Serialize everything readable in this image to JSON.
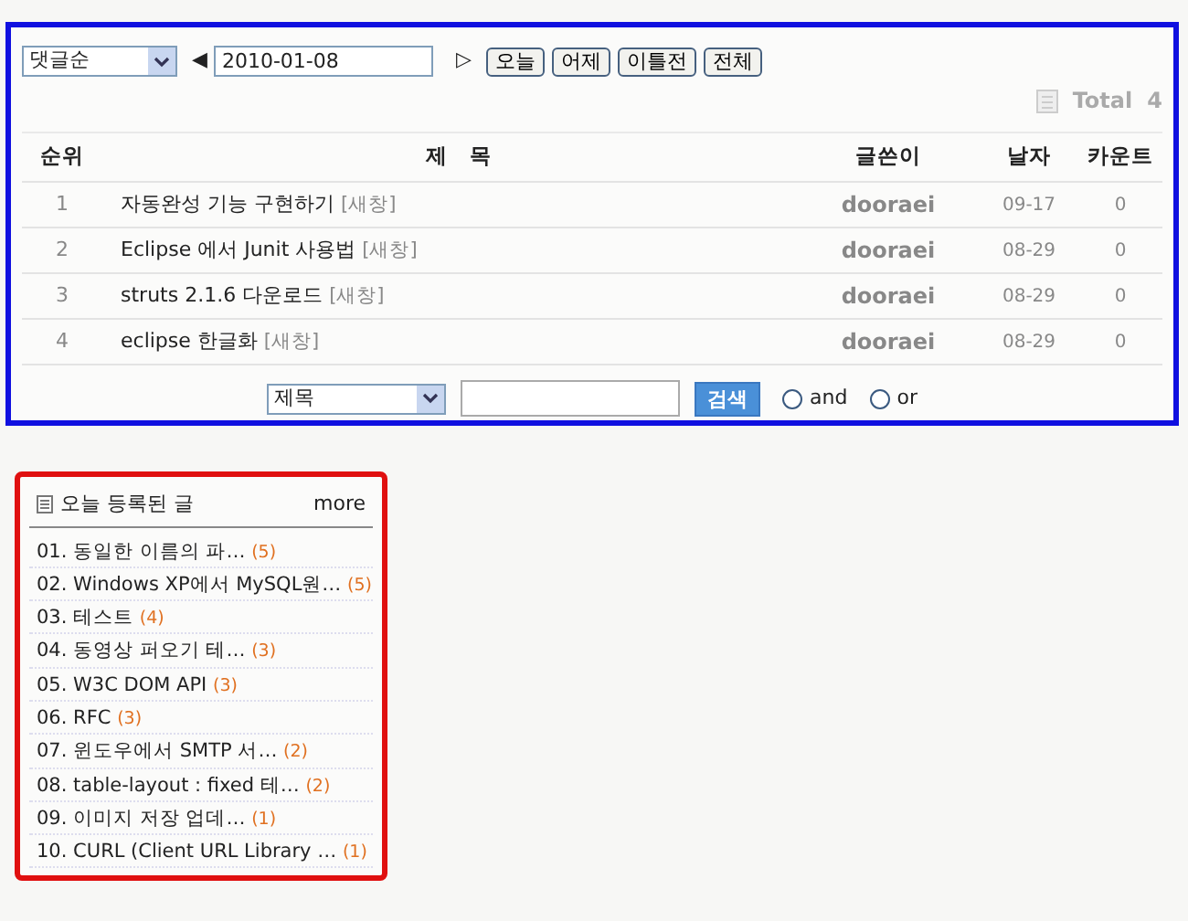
{
  "toolbar": {
    "sort_select": "댓글순",
    "prev_arrow": "◀",
    "date": "2010-01-08",
    "next_arrow": "▷",
    "buttons": [
      "오늘",
      "어제",
      "이틀전",
      "전체"
    ]
  },
  "total": {
    "label": "Total",
    "count": "4"
  },
  "table": {
    "columns": [
      "순위",
      "제　목",
      "글쓴이",
      "날자",
      "카운트"
    ],
    "rows": [
      {
        "rank": "1",
        "title": "자동완성 기능 구현하기 [새창]",
        "author": "dooraei",
        "date": "09-17",
        "count": "0"
      },
      {
        "rank": "2",
        "title": "Eclipse 에서 Junit 사용법 [새창]",
        "author": "dooraei",
        "date": "08-29",
        "count": "0"
      },
      {
        "rank": "3",
        "title": "struts 2.1.6 다운로드 [새창]",
        "author": "dooraei",
        "date": "08-29",
        "count": "0"
      },
      {
        "rank": "4",
        "title": "eclipse 한글화 [새창]",
        "author": "dooraei",
        "date": "08-29",
        "count": "0"
      }
    ]
  },
  "search": {
    "field_select": "제목",
    "button": "검색",
    "options": [
      {
        "label": "and",
        "selected": false
      },
      {
        "label": "or",
        "selected": false
      }
    ]
  },
  "today_posts": {
    "title": "오늘 등록된 글",
    "more": "more",
    "items": [
      {
        "number": "01.",
        "title": "동일한 이름의 파…",
        "count": "(5)"
      },
      {
        "number": "02.",
        "title": "Windows XP에서 MySQL원…",
        "count": "(5)"
      },
      {
        "number": "03.",
        "title": "테스트",
        "count": "(4)"
      },
      {
        "number": "04.",
        "title": "동영상 퍼오기 테…",
        "count": "(3)"
      },
      {
        "number": "05.",
        "title": "W3C DOM API",
        "count": "(3)"
      },
      {
        "number": "06.",
        "title": "RFC",
        "count": "(3)"
      },
      {
        "number": "07.",
        "title": "윈도우에서 SMTP 서…",
        "count": "(2)"
      },
      {
        "number": "08.",
        "title": "table-layout : fixed 테…",
        "count": "(2)"
      },
      {
        "number": "09.",
        "title": "이미지 저장 업데…",
        "count": "(1)"
      },
      {
        "number": "10.",
        "title": "CURL (Client URL Library …",
        "count": "(1)"
      }
    ]
  }
}
